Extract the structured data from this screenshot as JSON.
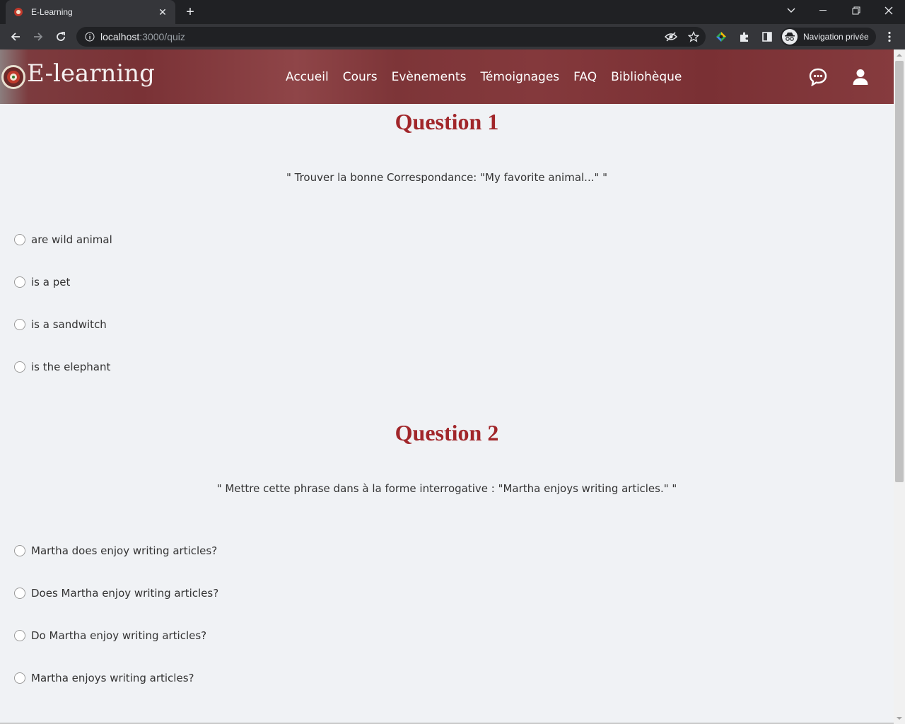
{
  "browser": {
    "tab_title": "E-Learning",
    "tab_close": "✕",
    "new_tab": "+",
    "url_host": "localhost",
    "url_path": ":3000/quiz",
    "profile_label": "Navigation privée"
  },
  "header": {
    "logo_text": "E-learning",
    "nav": [
      "Accueil",
      "Cours",
      "Evènements",
      "Témoignages",
      "FAQ",
      "Bibliohèque"
    ]
  },
  "questions": [
    {
      "title": "Question 1",
      "text": "\" Trouver la bonne Correspondance: \"My favorite animal...\" \"",
      "options": [
        "are wild animal",
        "is a pet",
        "is a sandwitch",
        "is the elephant"
      ]
    },
    {
      "title": "Question 2",
      "text": "\" Mettre cette phrase dans à la forme interrogative : \"Martha enjoys writing articles.\" \"",
      "options": [
        "Martha does enjoy writing articles?",
        "Does Martha enjoy writing articles?",
        "Do Martha enjoy writing articles?",
        "Martha enjoys writing articles?"
      ]
    }
  ],
  "colors": {
    "accent": "#a1262a",
    "header": "#7a3236",
    "background": "#f0f2f5"
  }
}
